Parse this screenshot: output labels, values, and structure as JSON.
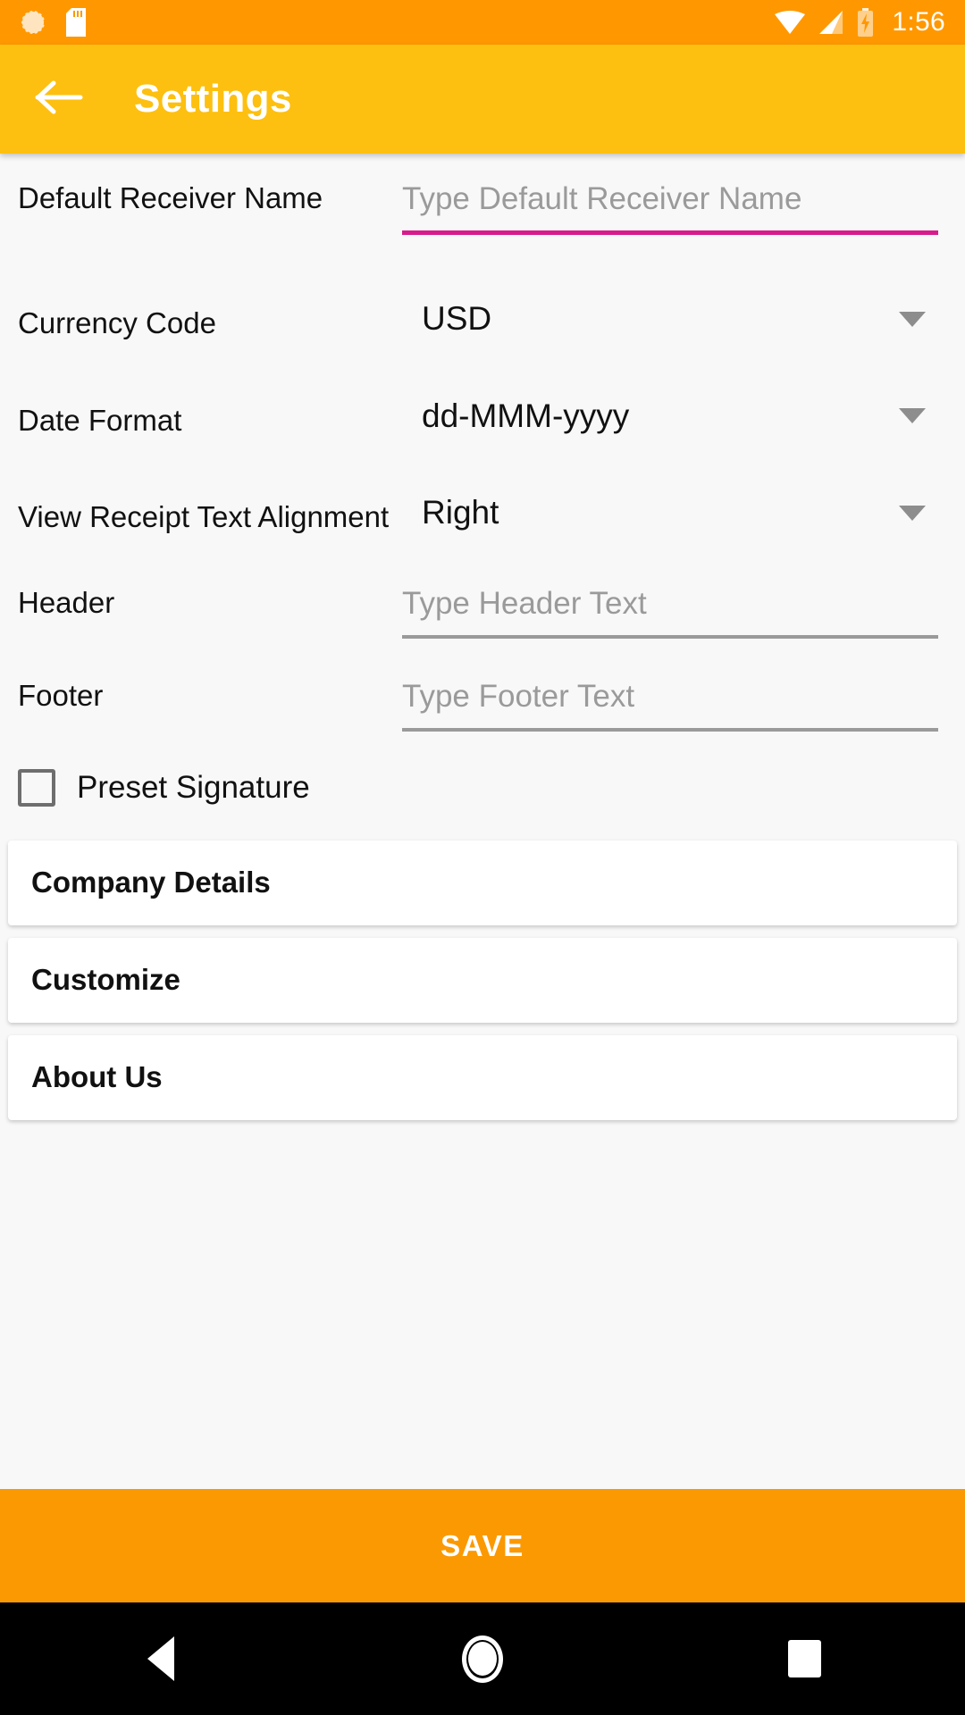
{
  "status_bar": {
    "time": "1:56",
    "icons": [
      "sync-icon",
      "sd-card-icon",
      "wifi-icon",
      "cellular-signal-icon",
      "battery-charging-icon"
    ],
    "background_color": "#FF9800"
  },
  "app_bar": {
    "title": "Settings",
    "back_icon": "arrow-back-icon",
    "background_color": "#FDC010"
  },
  "form": {
    "rows": [
      {
        "label": "Default Receiver Name",
        "type": "text",
        "value": "",
        "placeholder": "Type Default Receiver Name",
        "focused": true
      },
      {
        "label": "Currency Code",
        "type": "dropdown",
        "value": "USD"
      },
      {
        "label": "Date Format",
        "type": "dropdown",
        "value": "dd-MMM-yyyy"
      },
      {
        "label": "View Receipt Text Alignment",
        "type": "dropdown",
        "value": "Right"
      },
      {
        "label": "Header",
        "type": "text",
        "value": "",
        "placeholder": "Type Header Text",
        "focused": false
      },
      {
        "label": "Footer",
        "type": "text",
        "value": "",
        "placeholder": "Type Footer Text",
        "focused": false
      }
    ],
    "checkbox": {
      "label": "Preset Signature",
      "checked": false
    }
  },
  "cards": [
    {
      "label": "Company Details"
    },
    {
      "label": "Customize"
    },
    {
      "label": "About Us"
    }
  ],
  "save_button": {
    "label": "SAVE",
    "background_color": "#FB9903"
  },
  "nav_bar": {
    "back_label": "back-nav",
    "home_label": "home-nav",
    "recents_label": "recents-nav"
  },
  "colors": {
    "accent_focus_underline": "#D81B8C",
    "inactive_underline": "#9A9A9A",
    "placeholder_text": "#9A9A9A",
    "page_background": "#F8F8F8"
  }
}
